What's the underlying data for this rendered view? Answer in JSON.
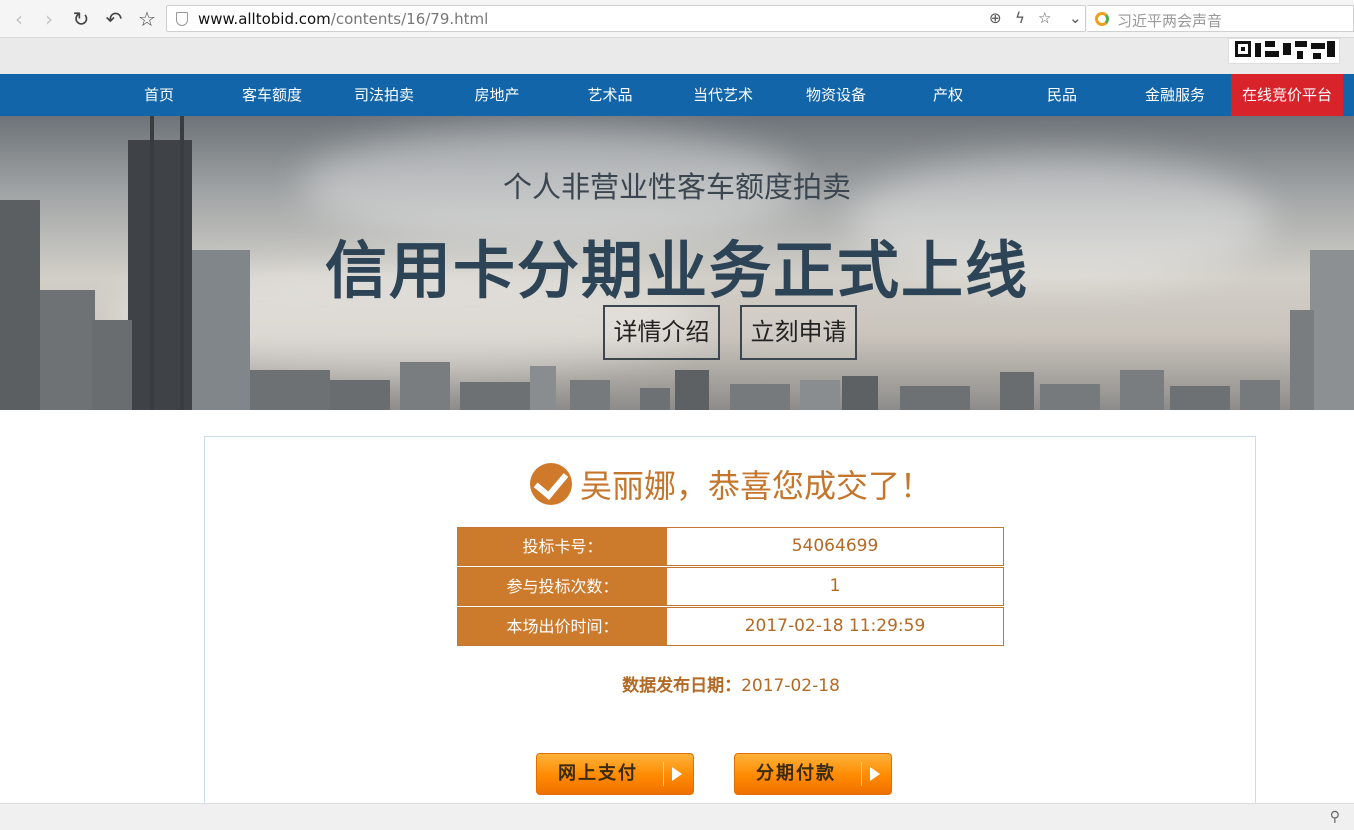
{
  "browser": {
    "url_host": "www.alltobid.com",
    "url_path": "/contents/16/79.html",
    "search_hint": "习近平两会声音"
  },
  "nav": {
    "items": [
      "首页",
      "客车额度",
      "司法拍卖",
      "房地产",
      "艺术品",
      "当代艺术",
      "物资设备",
      "产权",
      "民品",
      "金融服务"
    ],
    "highlight": "在线竞价平台"
  },
  "banner": {
    "subtitle": "个人非营业性客车额度拍卖",
    "title": "信用卡分期业务正式上线",
    "details_button": "详情介绍",
    "apply_button": "立刻申请"
  },
  "result": {
    "congrats": "吴丽娜，恭喜您成交了！",
    "rows": [
      {
        "label": "投标卡号：",
        "value": "54064699"
      },
      {
        "label": "参与投标次数：",
        "value": "1"
      },
      {
        "label": "本场出价时间：",
        "value": "2017-02-18 11:29:59"
      }
    ],
    "publish_label": "数据发布日期：",
    "publish_date": "2017-02-18",
    "pay_online": "网上支付",
    "pay_installment": "分期付款"
  },
  "colors": {
    "nav_blue": "#1165a8",
    "nav_highlight": "#d8232a",
    "accent_orange": "#cc7a2c",
    "pay_button": "#ff8a00"
  }
}
